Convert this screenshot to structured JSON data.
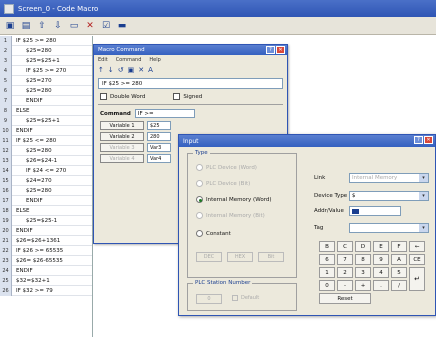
{
  "window": {
    "title": "Screen_0 - Code Macro"
  },
  "toolbar": {
    "icons": [
      "save-icon",
      "floppy-icon",
      "up-arrow-icon",
      "down-arrow-icon",
      "window-icon",
      "delete-icon",
      "check-window-icon",
      "monitor-icon"
    ]
  },
  "listing": {
    "rows": [
      {
        "num": "1",
        "code": "IF $25 >= 280",
        "indent": false
      },
      {
        "num": "2",
        "code": "$25=280",
        "indent": true
      },
      {
        "num": "3",
        "code": "$25=$25+1",
        "indent": true
      },
      {
        "num": "4",
        "code": "IF $25 >= 270",
        "indent": true
      },
      {
        "num": "5",
        "code": "$25=270",
        "indent": true
      },
      {
        "num": "6",
        "code": "$25=280",
        "indent": true
      },
      {
        "num": "7",
        "code": "ENDIF",
        "indent": true
      },
      {
        "num": "8",
        "code": "ELSE",
        "indent": false
      },
      {
        "num": "9",
        "code": "$25=$25+1",
        "indent": true
      },
      {
        "num": "10",
        "code": "ENDIF",
        "indent": false
      },
      {
        "num": "11",
        "code": "IF $25 <= 280",
        "indent": false
      },
      {
        "num": "12",
        "code": "$25=280",
        "indent": true
      },
      {
        "num": "13",
        "code": "$26=$24-1",
        "indent": true
      },
      {
        "num": "14",
        "code": "IF $24 <= 270",
        "indent": true
      },
      {
        "num": "15",
        "code": "$24=270",
        "indent": true
      },
      {
        "num": "16",
        "code": "$25=280",
        "indent": true
      },
      {
        "num": "17",
        "code": "ENDIF",
        "indent": true
      },
      {
        "num": "18",
        "code": "ELSE",
        "indent": false
      },
      {
        "num": "19",
        "code": "$25=$25-1",
        "indent": true
      },
      {
        "num": "20",
        "code": "ENDIF",
        "indent": false
      },
      {
        "num": "21",
        "code": "$26=$26+1361",
        "indent": false
      },
      {
        "num": "22",
        "code": "IF $26 >= 65535",
        "indent": false
      },
      {
        "num": "23",
        "code": "$26= $26-65535",
        "indent": false
      },
      {
        "num": "24",
        "code": "ENDIF",
        "indent": false
      },
      {
        "num": "25",
        "code": "$32=$32+1",
        "indent": false
      },
      {
        "num": "26",
        "code": "IF $32 >= 79",
        "indent": false
      }
    ]
  },
  "macro": {
    "title": "Macro Command",
    "menu": [
      "Edit",
      "Command",
      "Help"
    ],
    "tool_icons": [
      "↑",
      "↓",
      "↺",
      "▣",
      "✕",
      "A"
    ],
    "expression": "IF $25 >= 280",
    "double_word": "Double Word",
    "signed": "Signed",
    "command_label": "Command",
    "command_value": "IF >=",
    "variables": [
      {
        "label": "Variable 1",
        "value": "$25",
        "dim": false
      },
      {
        "label": "Variable 2",
        "value": "280",
        "dim": false
      },
      {
        "label": "Variable 3",
        "value": "Var3",
        "dim": true
      },
      {
        "label": "Variable 4",
        "value": "Var4",
        "dim": true
      }
    ]
  },
  "input": {
    "title": "Input",
    "type_legend": "Type",
    "types": [
      {
        "label": "PLC Device (Word)",
        "selected": false,
        "dim": true
      },
      {
        "label": "PLC Device (Bit)",
        "selected": false,
        "dim": true
      },
      {
        "label": "Internal Memory (Word)",
        "selected": true,
        "dim": false
      },
      {
        "label": "Internal Memory (Bit)",
        "selected": false,
        "dim": true
      },
      {
        "label": "Constant",
        "selected": false,
        "dim": false
      }
    ],
    "sub_buttons": [
      "DEC",
      "HEX",
      "Bit"
    ],
    "plc_station_legend": "PLC Station Number",
    "plc_station_value": "0",
    "default_label": "Default",
    "link_label": "Link",
    "link_value": "Internal Memory",
    "device_type_label": "Device Type",
    "device_type_value": "$",
    "addr_value_label": "Addr/Value",
    "tag_label": "Tag",
    "keys": [
      "B",
      "C",
      "D",
      "E",
      "F",
      "←",
      "6",
      "7",
      "8",
      "9",
      "A",
      "CE",
      "1",
      "2",
      "3",
      "4",
      "5",
      "↵",
      "0",
      "-",
      "+",
      ".",
      "/"
    ],
    "reset_label": "Reset"
  }
}
